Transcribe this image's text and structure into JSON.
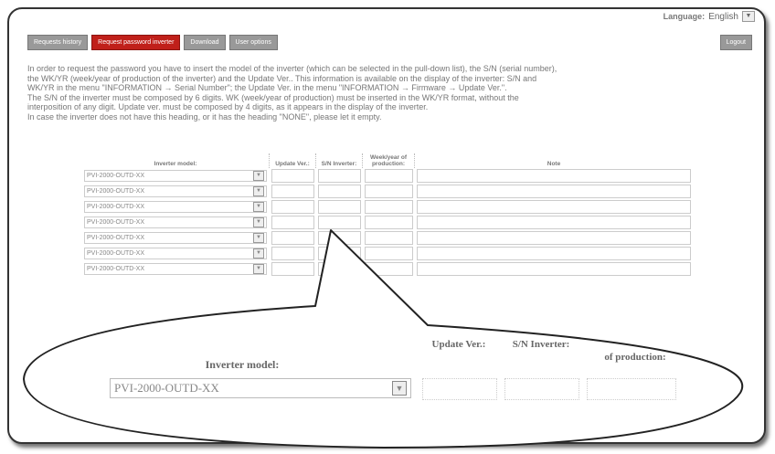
{
  "language": {
    "label": "Language:",
    "value": "English"
  },
  "tabs": [
    {
      "label": "Requests history"
    },
    {
      "label": "Request password inverter"
    },
    {
      "label": "Download"
    },
    {
      "label": "User options"
    }
  ],
  "logout_label": "Logout",
  "instructions": [
    "In order to request the password you have to insert the model of the inverter (which can be selected in the pull-down list), the S/N (serial number),",
    "the WK/YR (week/year of production of the inverter) and the Update Ver.. This information is available on the display of the inverter: S/N and",
    "WK/YR in the menu \"INFORMATION → Serial Number\"; the Update Ver. in the menu \"INFORMATION → Firmware → Update Ver.\".",
    "The S/N of the inverter must be composed by 6 digits. WK (week/year of production) must be inserted in the WK/YR format, without the",
    "interposition of any digit. Update ver. must be composed by 4 digits, as it appears in the display of the inverter.",
    "In case the inverter does not have this heading, or it has the heading \"NONE\", please let it empty."
  ],
  "table": {
    "headers": {
      "model": "Inverter model:",
      "update": "Update Ver.:",
      "sn": "S/N Inverter:",
      "week": "Week/year of production:",
      "note": "Note"
    },
    "rows": [
      {
        "model": "PVI-2000-OUTD-XX"
      },
      {
        "model": "PVI-2000-OUTD-XX"
      },
      {
        "model": "PVI-2000-OUTD-XX"
      },
      {
        "model": "PVI-2000-OUTD-XX"
      },
      {
        "model": "PVI-2000-OUTD-XX"
      },
      {
        "model": "PVI-2000-OUTD-XX"
      },
      {
        "model": "PVI-2000-OUTD-XX"
      }
    ]
  },
  "zoom": {
    "model": "Inverter model:",
    "update": "Update Ver.:",
    "sn": "S/N Inverter:",
    "week": "of production:",
    "select_value": "PVI-2000-OUTD-XX"
  },
  "colors": {
    "active_tab": "#c0201a",
    "tab": "#999999"
  }
}
